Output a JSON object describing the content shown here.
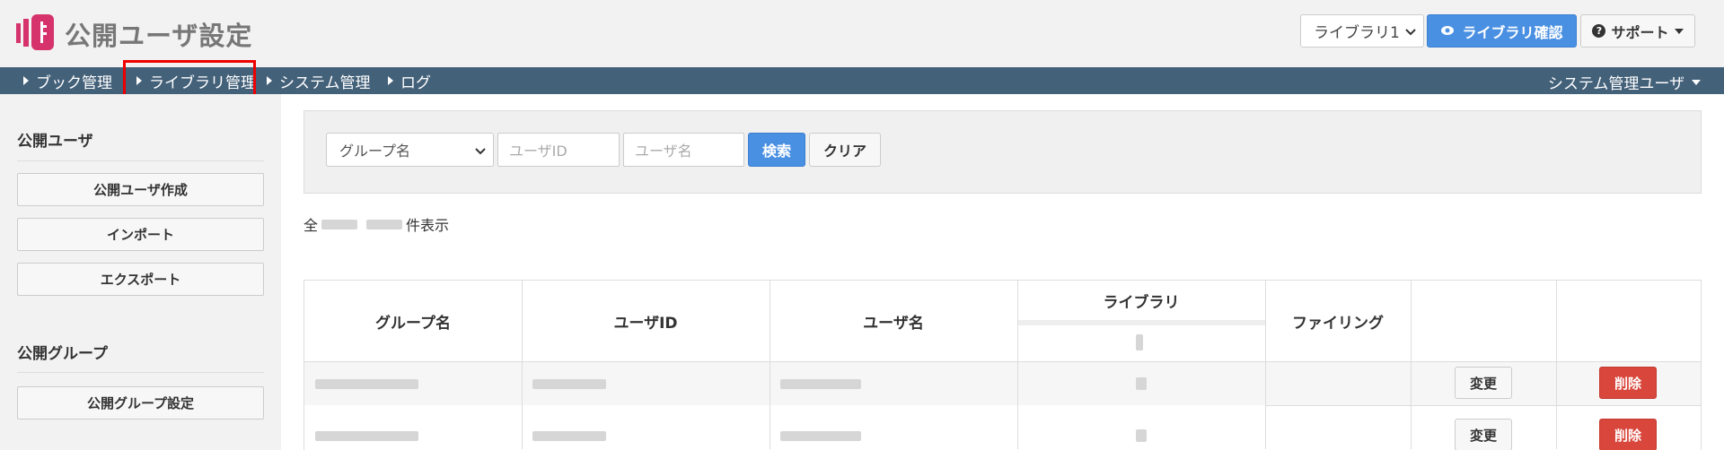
{
  "header": {
    "title": "公開ユーザ設定",
    "library_select": "ライブラリ1",
    "library_confirm_label": "ライブラリ確認",
    "support_label": "サポート",
    "brand_color": "#d6336c"
  },
  "nav": {
    "items": [
      "ブック管理",
      "ライブラリ管理",
      "システム管理",
      "ログ"
    ],
    "user_menu": "システム管理ユーザ",
    "highlighted": "ライブラリ管理"
  },
  "sidebar": {
    "section1_heading": "公開ユーザ",
    "section1_buttons": [
      "公開ユーザ作成",
      "インポート",
      "エクスポート"
    ],
    "section2_heading": "公開グループ",
    "section2_buttons": [
      "公開グループ設定"
    ]
  },
  "search": {
    "group_select": "グループ名",
    "user_id_placeholder": "ユーザID",
    "user_name_placeholder": "ユーザ名",
    "search_label": "検索",
    "clear_label": "クリア"
  },
  "count": {
    "prefix": "全",
    "suffix": "件表示"
  },
  "table": {
    "headers": [
      "グループ名",
      "ユーザID",
      "ユーザ名",
      "ライブラリ",
      "ファイリング"
    ],
    "edit_label": "変更",
    "delete_label": "削除"
  }
}
